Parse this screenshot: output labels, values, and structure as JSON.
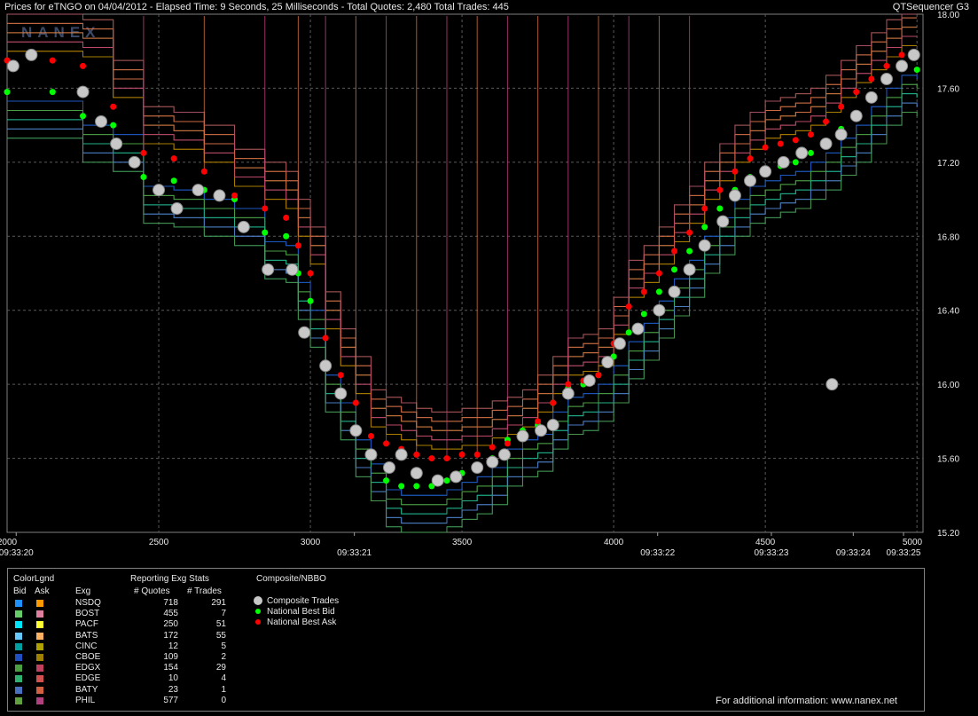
{
  "header": {
    "title": "Prices for  eTNGO  on  04/04/2012  -  Elapsed Time: 9 Seconds, 25 Milliseconds  -  Total Quotes: 2,480  Total Trades: 445",
    "app_name": "QTSequencer G3",
    "watermark": "NANEX"
  },
  "chart_data": {
    "type": "line",
    "title": "Prices for  eTNGO  on  04/04/2012",
    "x_ticks": [
      "2000",
      "2500",
      "3000",
      "3500",
      "4000",
      "4500",
      "5000"
    ],
    "x_tick_values": [
      2000,
      2500,
      3000,
      3500,
      4000,
      4500,
      5000
    ],
    "time_labels": [
      {
        "label": "09:33:20",
        "x": 2030
      },
      {
        "label": "09:33:21",
        "x": 3145
      },
      {
        "label": "09:33:22",
        "x": 4145
      },
      {
        "label": "09:33:23",
        "x": 4520
      },
      {
        "label": "09:33:24",
        "x": 4790
      },
      {
        "label": "09:33:25",
        "x": 5000
      }
    ],
    "y_ticks": [
      "18.00",
      "17.60",
      "17.20",
      "16.80",
      "16.40",
      "16.00",
      "15.60",
      "15.20"
    ],
    "xlim": [
      2000,
      5020
    ],
    "ylim": [
      15.2,
      18.0
    ],
    "grid": true,
    "series": [
      {
        "name": "National Best Bid",
        "color": "#00ff00",
        "x": [
          2000,
          2150,
          2250,
          2350,
          2450,
          2550,
          2650,
          2750,
          2850,
          2920,
          2960,
          3000,
          3050,
          3100,
          3150,
          3200,
          3250,
          3300,
          3350,
          3400,
          3450,
          3500,
          3550,
          3600,
          3650,
          3700,
          3750,
          3800,
          3850,
          3900,
          3950,
          4000,
          4050,
          4100,
          4150,
          4200,
          4250,
          4300,
          4350,
          4400,
          4450,
          4500,
          4550,
          4600,
          4650,
          4700,
          4750,
          4800,
          4850,
          4900,
          4950,
          5000
        ],
        "y": [
          17.58,
          17.58,
          17.45,
          17.4,
          17.12,
          17.1,
          17.05,
          17.0,
          16.82,
          16.8,
          16.6,
          16.45,
          16.1,
          15.95,
          15.75,
          15.62,
          15.48,
          15.45,
          15.45,
          15.45,
          15.48,
          15.52,
          15.55,
          15.6,
          15.7,
          15.75,
          15.78,
          15.9,
          15.98,
          16.0,
          16.05,
          16.15,
          16.28,
          16.38,
          16.5,
          16.62,
          16.72,
          16.85,
          16.95,
          17.05,
          17.12,
          17.15,
          17.18,
          17.2,
          17.25,
          17.3,
          17.38,
          17.45,
          17.55,
          17.65,
          17.72,
          17.7
        ]
      },
      {
        "name": "National Best Ask",
        "color": "#ff0000",
        "x": [
          2000,
          2150,
          2250,
          2350,
          2450,
          2550,
          2650,
          2750,
          2850,
          2920,
          2960,
          3000,
          3050,
          3100,
          3150,
          3200,
          3250,
          3300,
          3350,
          3400,
          3450,
          3500,
          3550,
          3600,
          3650,
          3700,
          3750,
          3800,
          3850,
          3900,
          3950,
          4000,
          4050,
          4100,
          4150,
          4200,
          4250,
          4300,
          4350,
          4400,
          4450,
          4500,
          4550,
          4600,
          4650,
          4700,
          4750,
          4800,
          4850,
          4900,
          4950,
          5000
        ],
        "y": [
          17.75,
          17.75,
          17.72,
          17.5,
          17.25,
          17.22,
          17.15,
          17.02,
          16.95,
          16.9,
          16.75,
          16.6,
          16.25,
          16.05,
          15.9,
          15.72,
          15.68,
          15.65,
          15.62,
          15.6,
          15.6,
          15.62,
          15.62,
          15.66,
          15.68,
          15.72,
          15.8,
          15.9,
          16.0,
          16.02,
          16.05,
          16.22,
          16.42,
          16.5,
          16.6,
          16.72,
          16.82,
          16.95,
          17.05,
          17.15,
          17.22,
          17.28,
          17.3,
          17.32,
          17.35,
          17.42,
          17.5,
          17.58,
          17.65,
          17.72,
          17.78,
          17.78
        ]
      },
      {
        "name": "Composite Trades",
        "color": "#c8c8c8",
        "x": [
          2020,
          2080,
          2250,
          2310,
          2360,
          2420,
          2500,
          2560,
          2630,
          2700,
          2780,
          2860,
          2940,
          2980,
          3050,
          3100,
          3150,
          3200,
          3260,
          3300,
          3350,
          3420,
          3480,
          3550,
          3600,
          3640,
          3700,
          3760,
          3800,
          3850,
          3920,
          3980,
          4020,
          4080,
          4150,
          4200,
          4250,
          4300,
          4360,
          4400,
          4450,
          4500,
          4560,
          4620,
          4700,
          4750,
          4800,
          4850,
          4900,
          4950,
          4990,
          4720
        ],
        "y": [
          17.72,
          17.78,
          17.58,
          17.42,
          17.3,
          17.2,
          17.05,
          16.95,
          17.05,
          17.02,
          16.85,
          16.62,
          16.62,
          16.28,
          16.1,
          15.95,
          15.75,
          15.62,
          15.55,
          15.62,
          15.52,
          15.48,
          15.5,
          15.55,
          15.58,
          15.62,
          15.72,
          15.75,
          15.78,
          15.95,
          16.02,
          16.12,
          16.22,
          16.3,
          16.4,
          16.5,
          16.62,
          16.75,
          16.88,
          17.02,
          17.1,
          17.15,
          17.2,
          17.25,
          17.3,
          17.35,
          17.45,
          17.55,
          17.65,
          17.72,
          17.78,
          16.0
        ]
      }
    ]
  },
  "legend": {
    "headers": {
      "color_legend": "ColorLgnd",
      "bid": "Bid",
      "ask": "Ask",
      "exch": "Exg",
      "reporting": "Reporting Exg Stats",
      "quotes": "# Quotes",
      "trades": "# Trades",
      "composite": "Composite/NBBO"
    },
    "exchanges": [
      {
        "name": "NSDQ",
        "bid_color": "#1e90ff",
        "ask_color": "#ff9a00",
        "quotes": "718",
        "trades": "291"
      },
      {
        "name": "BOST",
        "bid_color": "#66cc66",
        "ask_color": "#e080a0",
        "quotes": "455",
        "trades": "7"
      },
      {
        "name": "PACF",
        "bid_color": "#00e5ff",
        "ask_color": "#ffff33",
        "quotes": "250",
        "trades": "51"
      },
      {
        "name": "BATS",
        "bid_color": "#66c8ff",
        "ask_color": "#ffb060",
        "quotes": "172",
        "trades": "55"
      },
      {
        "name": "CINC",
        "bid_color": "#00a0a0",
        "ask_color": "#b0a000",
        "quotes": "12",
        "trades": "5"
      },
      {
        "name": "CBOE",
        "bid_color": "#2050c0",
        "ask_color": "#a08000",
        "quotes": "109",
        "trades": "2"
      },
      {
        "name": "EDGX",
        "bid_color": "#4aa040",
        "ask_color": "#c04060",
        "quotes": "154",
        "trades": "29"
      },
      {
        "name": "EDGE",
        "bid_color": "#30b070",
        "ask_color": "#d05050",
        "quotes": "10",
        "trades": "4"
      },
      {
        "name": "BATY",
        "bid_color": "#4a70c0",
        "ask_color": "#d06040",
        "quotes": "23",
        "trades": "1"
      },
      {
        "name": "PHIL",
        "bid_color": "#60a040",
        "ask_color": "#b04080",
        "quotes": "577",
        "trades": "0"
      }
    ],
    "composite_items": [
      {
        "label": "Composite Trades",
        "color": "#c8c8c8"
      },
      {
        "label": "National Best Bid",
        "color": "#00ff00"
      },
      {
        "label": "National Best Ask",
        "color": "#ff0000"
      }
    ],
    "footer": "For additional information: www.nanex.net"
  }
}
